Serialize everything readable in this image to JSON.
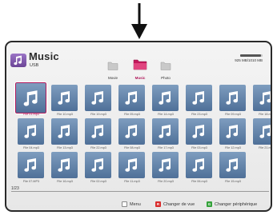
{
  "header": {
    "title": "Music",
    "subtitle": "USB",
    "capacity_text": "925 MB/1010 MB",
    "capacity_used_fraction": 0.92
  },
  "categories": [
    {
      "label": "Movie",
      "icon": "folder-icon",
      "selected": false
    },
    {
      "label": "Music",
      "icon": "folder-open-icon",
      "selected": true
    },
    {
      "label": "Photo",
      "icon": "folder-icon",
      "selected": false
    }
  ],
  "files": [
    {
      "name": "File 01.mp3",
      "selected": true
    },
    {
      "name": "File 04.mp3"
    },
    {
      "name": "File 07.MP3"
    },
    {
      "name": "File 10.mp3"
    },
    {
      "name": "File 13.mp3"
    },
    {
      "name": "File 16.mp3"
    },
    {
      "name": "File 19.mp3"
    },
    {
      "name": "File 22.mp3"
    },
    {
      "name": "File 02.mp3"
    },
    {
      "name": "File 05.mp3"
    },
    {
      "name": "File 08.mp3"
    },
    {
      "name": "File 11.mp3"
    },
    {
      "name": "File 14.mp3"
    },
    {
      "name": "File 17.mp3"
    },
    {
      "name": "File 20.mp3"
    },
    {
      "name": "File 23.mp3"
    },
    {
      "name": "File 03.mp3"
    },
    {
      "name": "File 06.mp3"
    },
    {
      "name": "File 09.mp3"
    },
    {
      "name": "File 12.mp3"
    },
    {
      "name": "File 15.mp3"
    },
    {
      "name": "File 18.mp3"
    },
    {
      "name": "File 21.mp3"
    }
  ],
  "pager": {
    "label": "1/23"
  },
  "footer": {
    "menu_label": "Menu",
    "red_label": "Changer de vue",
    "red_key": "R",
    "green_label": "Changer périphérique",
    "green_key": "G"
  },
  "colors": {
    "accent": "#b0175a",
    "tile": "#5f80a8",
    "red_key": "#d92b2b",
    "green_key": "#34a23a"
  }
}
